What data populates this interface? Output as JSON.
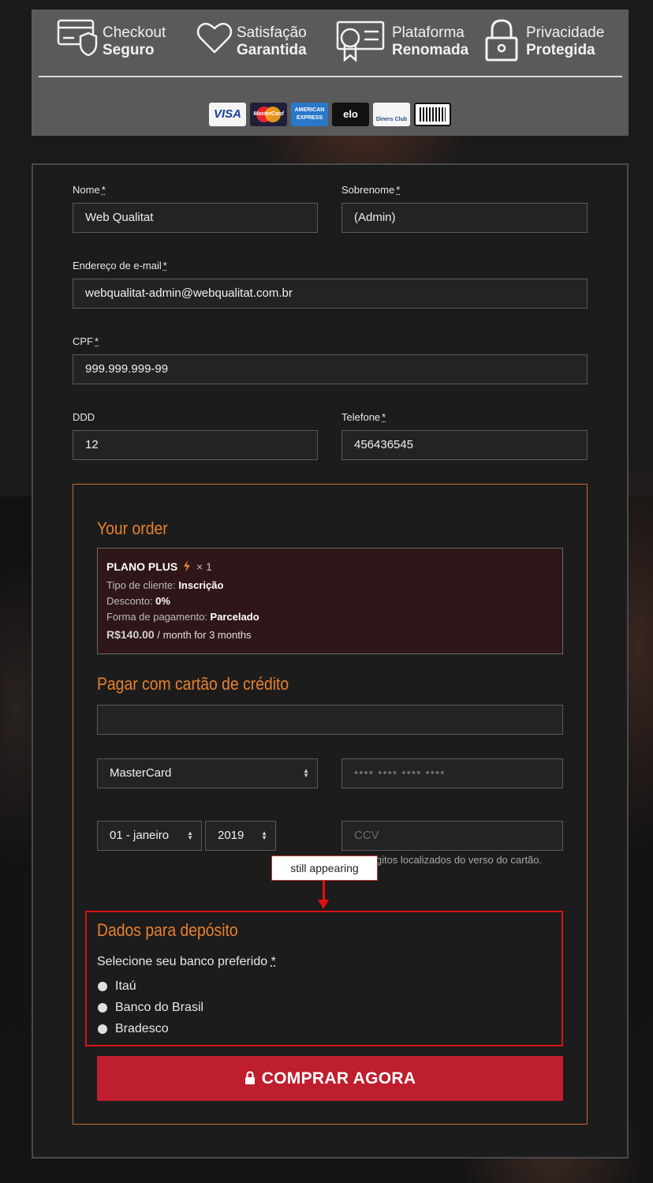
{
  "trust_bar": {
    "badges": [
      {
        "line1": "Checkout",
        "line2": "Seguro",
        "icon": "secure-card-shield-icon"
      },
      {
        "line1": "Satisfação",
        "line2": "Garantida",
        "icon": "heart-icon"
      },
      {
        "line1": "Plataforma",
        "line2": "Renomada",
        "icon": "certificate-icon"
      },
      {
        "line1": "Privacidade",
        "line2": "Protegida",
        "icon": "padlock-icon"
      }
    ],
    "payment_logos": [
      "VISA",
      "MasterCard",
      "AMERICAN EXPRESS",
      "elo",
      "Diners Club",
      "boleto"
    ]
  },
  "form": {
    "first_name": {
      "label": "Nome",
      "required": "*",
      "value": "Web Qualitat"
    },
    "last_name": {
      "label": "Sobrenome",
      "required": "*",
      "value": "(Admin)"
    },
    "email": {
      "label": "Endereço de e-mail",
      "required": "*",
      "value": "webqualitat-admin@webqualitat.com.br"
    },
    "cpf": {
      "label": "CPF",
      "required": "*",
      "value": "999.999.999-99"
    },
    "ddd": {
      "label": "DDD",
      "value": "12"
    },
    "phone": {
      "label": "Telefone",
      "required": "*",
      "value": "456436545"
    }
  },
  "order": {
    "heading": "Your order",
    "product": "PLANO PLUS",
    "quantity": "× 1",
    "client_type_label": "Tipo de cliente:",
    "client_type_value": "Inscrição",
    "discount_label": "Desconto:",
    "discount_value": "0%",
    "payment_form_label": "Forma de pagamento:",
    "payment_form_value": "Parcelado",
    "price": "R$140.00",
    "price_suffix": "/ month for 3 months"
  },
  "credit_card": {
    "heading": "Pagar com cartão de crédito",
    "holder_value": "",
    "brand_selected": "MasterCard",
    "number_placeholder": "•••• •••• •••• ••••",
    "month_selected": "01 - janeiro",
    "year_selected": "2019",
    "ccv_placeholder": "CCV",
    "ccv_help": "dígitos localizados do verso do cartão."
  },
  "annotation": {
    "label": "still appearing",
    "color": "#e01010"
  },
  "deposit": {
    "heading": "Dados para depósito",
    "prompt": "Selecione seu banco preferido",
    "required": "*",
    "banks": [
      "Itaú",
      "Banco do Brasil",
      "Bradesco"
    ]
  },
  "buy_button": {
    "label": "COMPRAR AGORA",
    "icon": "lock-icon"
  },
  "colors": {
    "accent_orange": "#e8802f",
    "button_red": "#be1e2d",
    "order_bg": "#2f1618"
  }
}
